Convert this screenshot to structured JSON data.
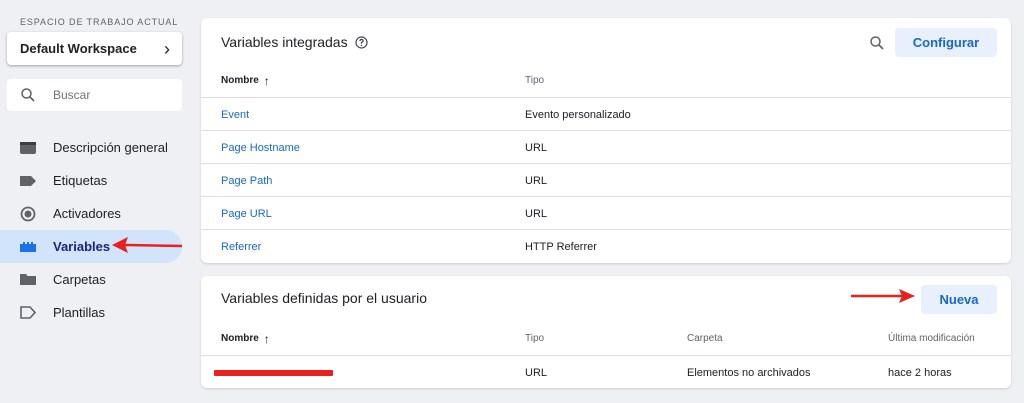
{
  "sidebar": {
    "workspace_label": "ESPACIO DE TRABAJO ACTUAL",
    "workspace_name": "Default Workspace",
    "search_placeholder": "Buscar",
    "items": [
      {
        "label": "Descripción general",
        "icon": "overview-icon"
      },
      {
        "label": "Etiquetas",
        "icon": "tag-icon"
      },
      {
        "label": "Activadores",
        "icon": "trigger-icon"
      },
      {
        "label": "Variables",
        "icon": "variables-icon",
        "active": true
      },
      {
        "label": "Carpetas",
        "icon": "folder-icon"
      },
      {
        "label": "Plantillas",
        "icon": "template-icon"
      }
    ]
  },
  "builtin": {
    "title": "Variables integradas",
    "configure_label": "Configurar",
    "headers": {
      "name": "Nombre",
      "type": "Tipo"
    },
    "rows": [
      {
        "name": "Event",
        "type": "Evento personalizado"
      },
      {
        "name": "Page Hostname",
        "type": "URL"
      },
      {
        "name": "Page Path",
        "type": "URL"
      },
      {
        "name": "Page URL",
        "type": "URL"
      },
      {
        "name": "Referrer",
        "type": "HTTP Referrer"
      }
    ]
  },
  "user_defined": {
    "title": "Variables definidas por el usuario",
    "new_label": "Nueva",
    "headers": {
      "name": "Nombre",
      "type": "Tipo",
      "folder": "Carpeta",
      "modified": "Última modificación"
    },
    "rows": [
      {
        "type": "URL",
        "folder": "Elementos no archivados",
        "modified": "hace 2 horas"
      }
    ]
  },
  "colors": {
    "accent": "#1967d2",
    "annotation": "#e8201e",
    "active_bg": "#d2e3fc"
  }
}
